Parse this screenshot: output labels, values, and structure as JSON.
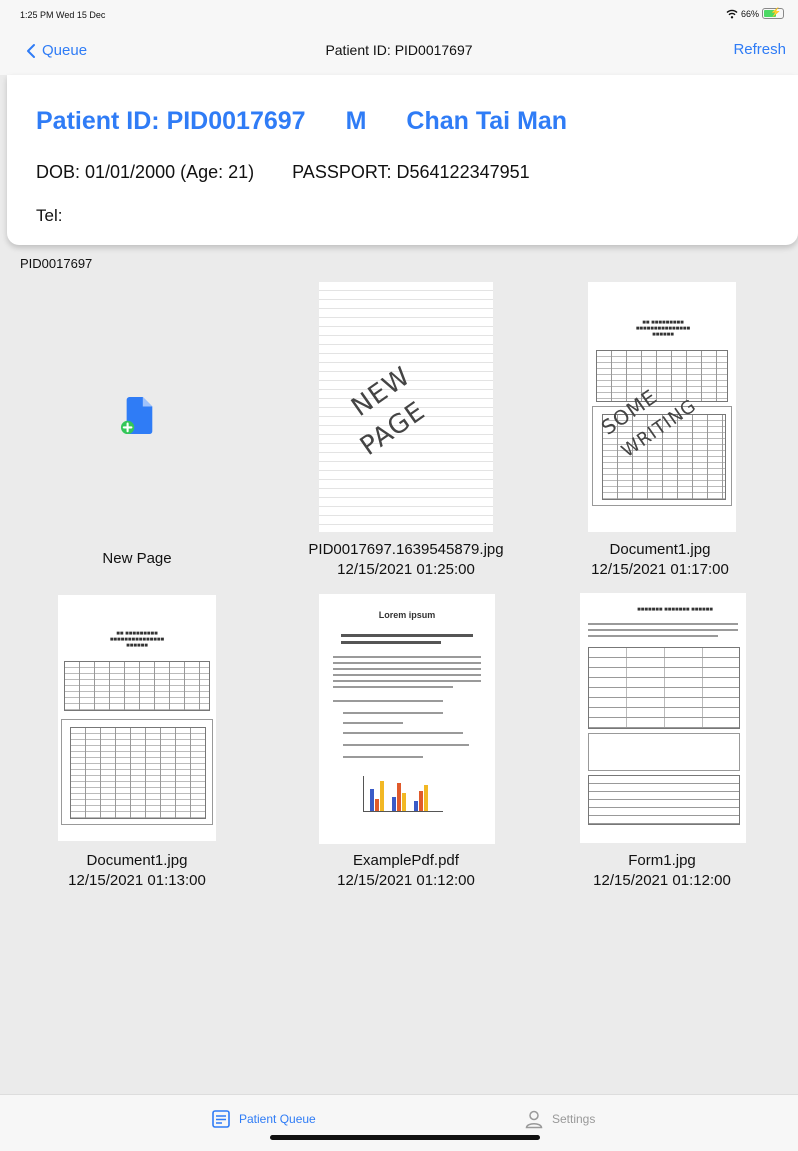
{
  "status_bar": {
    "time": "1:25 PM  Wed 15 Dec",
    "battery": "66%",
    "battery_level": 0.66
  },
  "nav": {
    "back_label": "Queue",
    "title": "Patient ID: PID0017697",
    "refresh_label": "Refresh"
  },
  "patient": {
    "id": "Patient ID: PID0017697",
    "sex": "M",
    "name": "Chan Tai Man",
    "dob": "DOB: 01/01/2000 (Age: 21)",
    "passport": "PASSPORT: D564122347951",
    "tel": "Tel:"
  },
  "folder_label": "PID0017697",
  "documents": [
    {
      "name": "New Page",
      "date": "",
      "icon": "new-page-icon"
    },
    {
      "name": "PID0017697.1639545879.jpg",
      "date": "12/15/2021 01:25:00",
      "handwriting": [
        "NEW",
        "PAGE"
      ]
    },
    {
      "name": "Document1.jpg",
      "date": "12/15/2021 01:17:00",
      "handwriting": [
        "SOME",
        "WRITING"
      ]
    },
    {
      "name": "Document1.jpg",
      "date": "12/15/2021 01:13:00"
    },
    {
      "name": "ExamplePdf.pdf",
      "date": "12/15/2021 01:12:00",
      "thumb_title": "Lorem ipsum"
    },
    {
      "name": "Form1.jpg",
      "date": "12/15/2021 01:12:00"
    }
  ],
  "tabs": [
    {
      "label": "Patient Queue",
      "active": true,
      "icon": "list-icon"
    },
    {
      "label": "Settings",
      "active": false,
      "icon": "person-icon"
    }
  ],
  "colors": {
    "accent": "#2f7cf6",
    "background": "#ebebeb",
    "new_page_blue": "#2f7cf6",
    "new_page_green": "#34c759"
  }
}
